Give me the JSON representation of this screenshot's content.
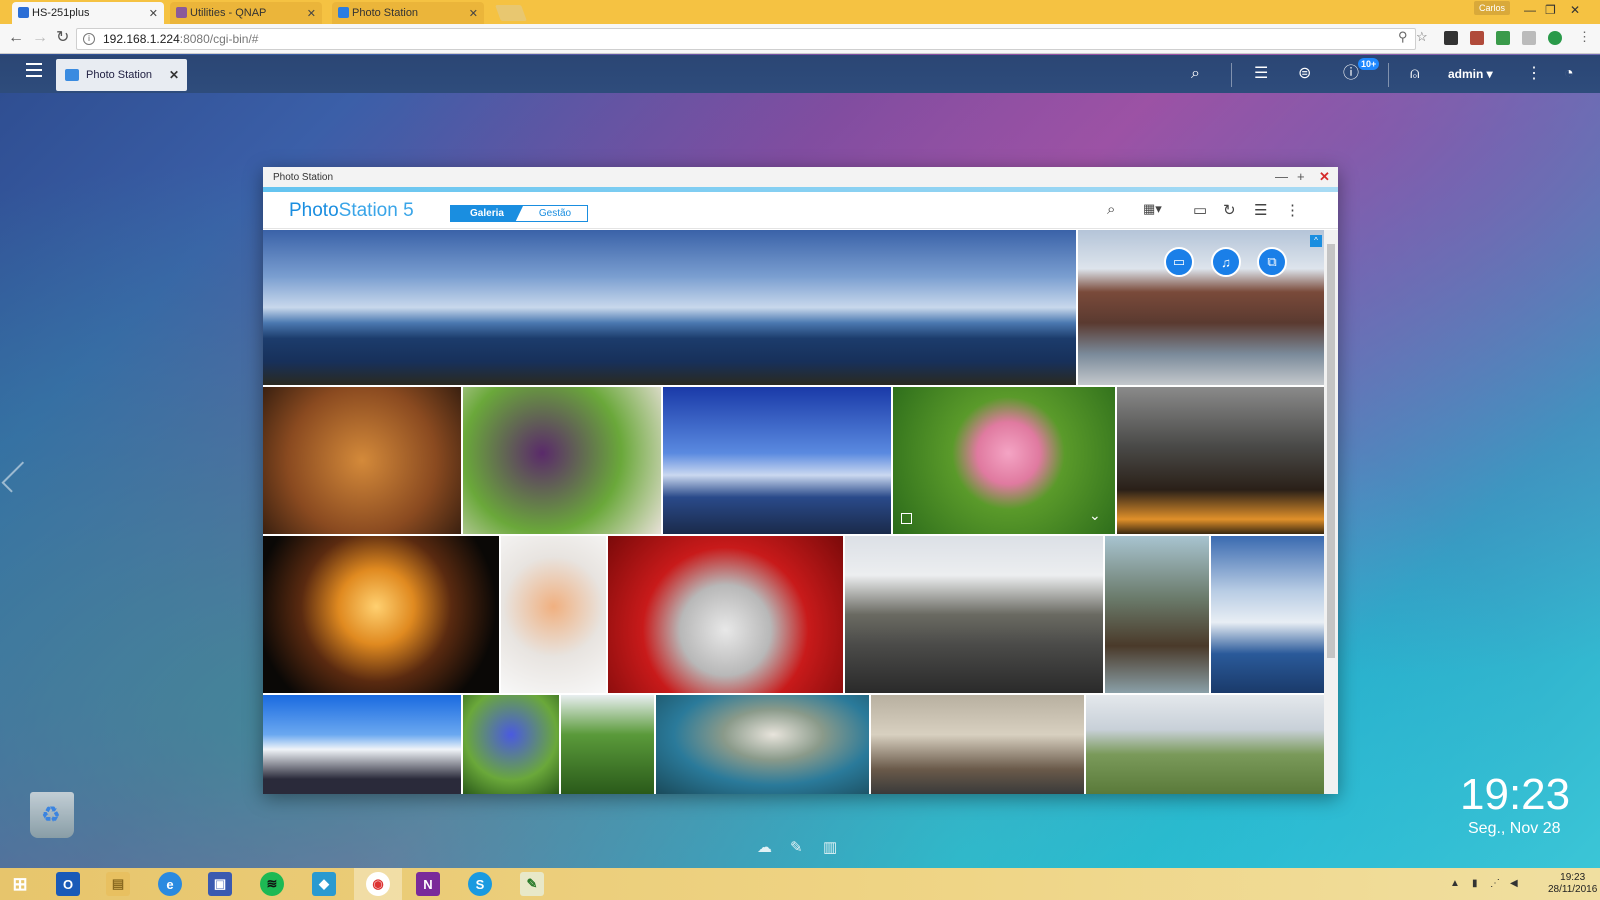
{
  "browser": {
    "tabs": [
      {
        "label": "HS-251plus",
        "active": true
      },
      {
        "label": "Utilities - QNAP",
        "active": false
      },
      {
        "label": "Photo Station",
        "active": false
      }
    ],
    "user": "Carlos",
    "url_host": "192.168.1.224",
    "url_path": ":8080/cgi-bin/#"
  },
  "qts": {
    "app_tab": "Photo Station",
    "notification_count": "10+",
    "user": "admin ▾"
  },
  "window": {
    "title": "Photo Station",
    "logo_bold": "Photo",
    "logo_rest": "Station 5",
    "mode_tabs": [
      "Galeria",
      "Gestão"
    ],
    "active_mode": "Galeria"
  },
  "desktop": {
    "time": "19:23",
    "date": "Seg., Nov 28"
  },
  "taskbar": {
    "time": "19:23",
    "date": "28/11/2016"
  },
  "colors": {
    "accent": "#1a8ee0",
    "tab_strip": "#f5c242",
    "qts_bar": "#2b4674"
  }
}
